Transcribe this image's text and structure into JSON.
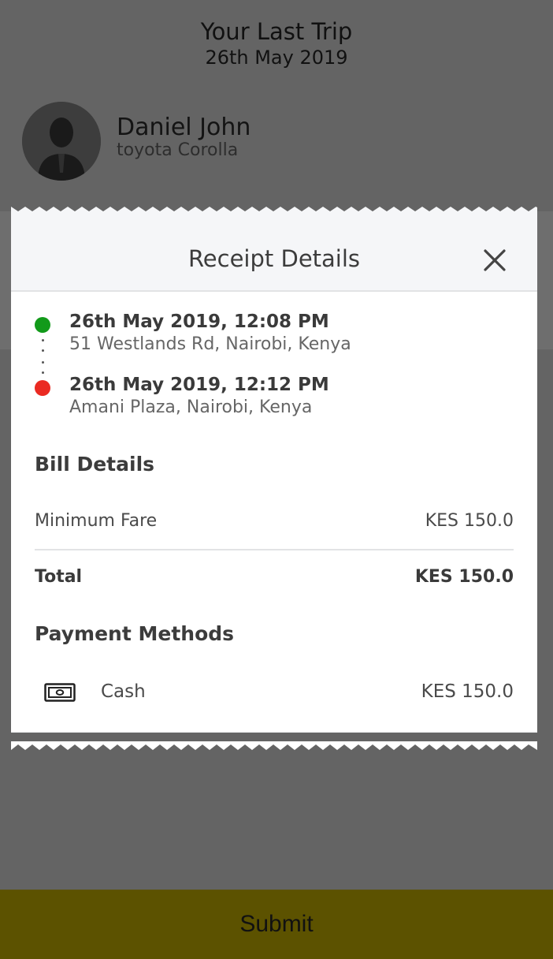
{
  "trip": {
    "title": "Your Last Trip",
    "date": "26th May 2019"
  },
  "driver": {
    "name": "Daniel John",
    "car": "toyota Corolla"
  },
  "receipt": {
    "title": "Receipt Details",
    "pickup": {
      "time": "26th May 2019, 12:08 PM",
      "address": "51 Westlands Rd, Nairobi, Kenya",
      "color": "#129a1a"
    },
    "dropoff": {
      "time": "26th May 2019, 12:12 PM",
      "address": "Amani Plaza, Nairobi, Kenya",
      "color": "#ea2a22"
    },
    "bill": {
      "title": "Bill Details",
      "items": [
        {
          "label": "Minimum Fare",
          "value": "KES 150.0"
        }
      ],
      "total_label": "Total",
      "total_value": "KES 150.0"
    },
    "payment": {
      "title": "Payment Methods",
      "method": "Cash",
      "icon": "cash-icon",
      "amount": "KES 150.0"
    }
  },
  "submit_label": "Submit",
  "colors": {
    "background": "#646464",
    "submit": "#5c5200"
  }
}
